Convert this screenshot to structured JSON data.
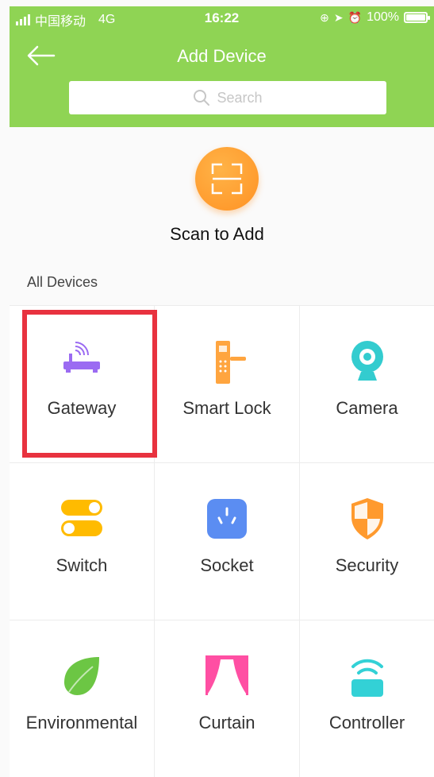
{
  "status_bar": {
    "carrier": "中国移动",
    "network": "4G",
    "time": "16:22",
    "battery": "100%"
  },
  "header": {
    "title": "Add Device",
    "back_icon": "back-arrow-icon",
    "search_placeholder": "Search"
  },
  "scan": {
    "label": "Scan to Add",
    "icon": "scan-icon"
  },
  "devices_section": {
    "title": "All Devices",
    "items": [
      {
        "label": "Gateway",
        "icon": "gateway-icon",
        "color": "#9b6bf2"
      },
      {
        "label": "Smart Lock",
        "icon": "smart-lock-icon",
        "color": "#ffa53f"
      },
      {
        "label": "Camera",
        "icon": "camera-icon",
        "color": "#33cccf"
      },
      {
        "label": "Switch",
        "icon": "switch-icon",
        "color": "#ffbb00"
      },
      {
        "label": "Socket",
        "icon": "socket-icon",
        "color": "#5b8df2"
      },
      {
        "label": "Security",
        "icon": "security-icon",
        "color": "#ff9a2e"
      },
      {
        "label": "Environmental",
        "icon": "environmental-icon",
        "color": "#6cc644"
      },
      {
        "label": "Curtain",
        "icon": "curtain-icon",
        "color": "#ff4fa3"
      },
      {
        "label": "Controller",
        "icon": "controller-icon",
        "color": "#33d1d6"
      }
    ]
  },
  "colors": {
    "header_bg": "#8fd454",
    "scan_button": "#ff9224",
    "highlight": "#e8323f"
  }
}
